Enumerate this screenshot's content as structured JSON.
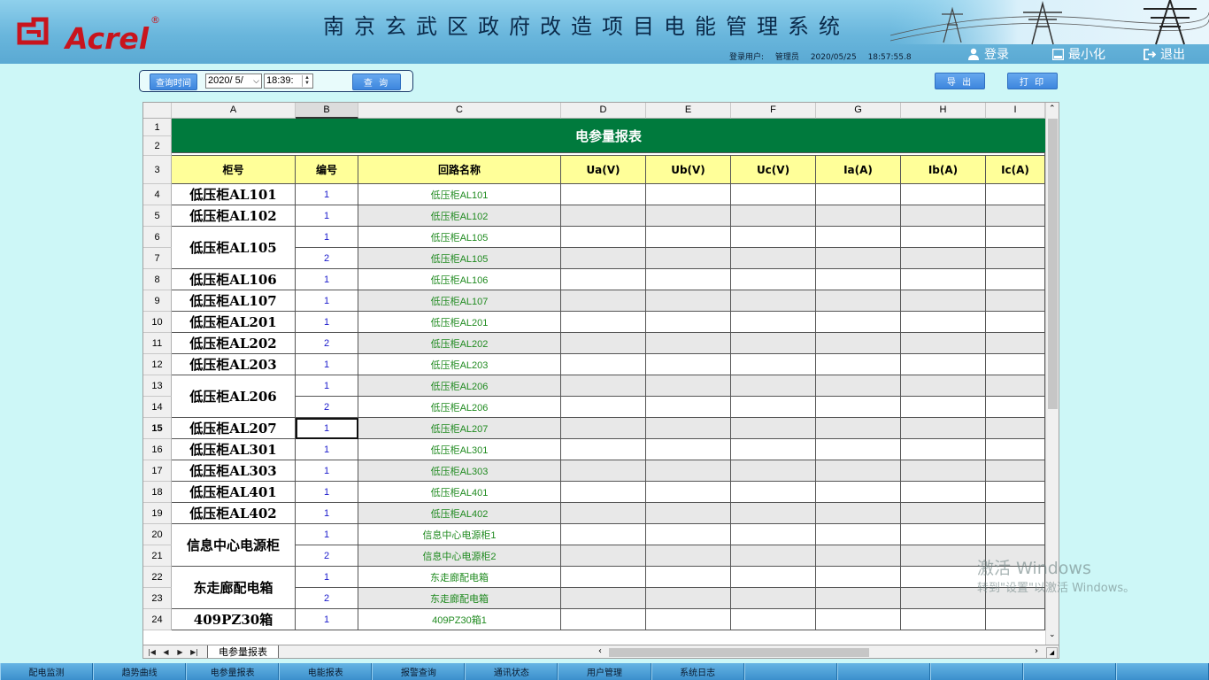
{
  "header": {
    "logo_text": "Acrel",
    "logo_reg": "®",
    "system_title": "南京玄武区政府改造项目电能管理系统",
    "user_label": "登录用户:",
    "user_name": "管理员",
    "date": "2020/05/25",
    "time": "18:57:55.8",
    "login_label": "登录",
    "minimize_label": "最小化",
    "exit_label": "退出"
  },
  "query": {
    "query_time_label": "查询时间",
    "date_value": "2020/ 5/",
    "time_value": "18:39:",
    "query_button": "查 询",
    "export_button": "导 出",
    "print_button": "打 印"
  },
  "sheet": {
    "columns": [
      "A",
      "B",
      "C",
      "D",
      "E",
      "F",
      "G",
      "H",
      "I"
    ],
    "title": "电参量报表",
    "headers": [
      "柜号",
      "编号",
      "回路名称",
      "Ua(V)",
      "Ub(V)",
      "Uc(V)",
      "Ia(A)",
      "Ib(A)",
      "Ic(A)"
    ],
    "row_numbers": [
      "1",
      "2",
      "3",
      "4",
      "5",
      "6",
      "7",
      "8",
      "9",
      "10",
      "11",
      "12",
      "13",
      "14",
      "15",
      "16",
      "17",
      "18",
      "19",
      "20",
      "21",
      "22",
      "23",
      "24"
    ],
    "rows": [
      {
        "cabinet": "低压柜AL101",
        "span": 1,
        "num": "1",
        "loop": "低压柜AL101"
      },
      {
        "cabinet": "低压柜AL102",
        "span": 1,
        "num": "1",
        "loop": "低压柜AL102"
      },
      {
        "cabinet": "低压柜AL105",
        "span": 2,
        "num": "1",
        "loop": "低压柜AL105"
      },
      {
        "cabinet": "",
        "span": 0,
        "num": "2",
        "loop": "低压柜AL105"
      },
      {
        "cabinet": "低压柜AL106",
        "span": 1,
        "num": "1",
        "loop": "低压柜AL106"
      },
      {
        "cabinet": "低压柜AL107",
        "span": 1,
        "num": "1",
        "loop": "低压柜AL107"
      },
      {
        "cabinet": "低压柜AL201",
        "span": 1,
        "num": "1",
        "loop": "低压柜AL201"
      },
      {
        "cabinet": "低压柜AL202",
        "span": 1,
        "num": "2",
        "loop": "低压柜AL202"
      },
      {
        "cabinet": "低压柜AL203",
        "span": 1,
        "num": "1",
        "loop": "低压柜AL203"
      },
      {
        "cabinet": "低压柜AL206",
        "span": 2,
        "num": "1",
        "loop": "低压柜AL206"
      },
      {
        "cabinet": "",
        "span": 0,
        "num": "2",
        "loop": "低压柜AL206"
      },
      {
        "cabinet": "低压柜AL207",
        "span": 1,
        "num": "1",
        "loop": "低压柜AL207"
      },
      {
        "cabinet": "低压柜AL301",
        "span": 1,
        "num": "1",
        "loop": "低压柜AL301"
      },
      {
        "cabinet": "低压柜AL303",
        "span": 1,
        "num": "1",
        "loop": "低压柜AL303"
      },
      {
        "cabinet": "低压柜AL401",
        "span": 1,
        "num": "1",
        "loop": "低压柜AL401"
      },
      {
        "cabinet": "低压柜AL402",
        "span": 1,
        "num": "1",
        "loop": "低压柜AL402"
      },
      {
        "cabinet": "信息中心电源柜",
        "span": 2,
        "num": "1",
        "loop": "信息中心电源柜1"
      },
      {
        "cabinet": "",
        "span": 0,
        "num": "2",
        "loop": "信息中心电源柜2"
      },
      {
        "cabinet": "东走廊配电箱",
        "span": 2,
        "num": "1",
        "loop": "东走廊配电箱"
      },
      {
        "cabinet": "",
        "span": 0,
        "num": "2",
        "loop": "东走廊配电箱"
      },
      {
        "cabinet": "409PZ30箱",
        "span": 1,
        "num": "1",
        "loop": "409PZ30箱1"
      }
    ],
    "tab_label": "电参量报表"
  },
  "watermark": {
    "line1": "激活 Windows",
    "line2": "转到\"设置\"以激活 Windows。"
  },
  "bottom_nav": [
    "配电监测",
    "趋势曲线",
    "电参量报表",
    "电能报表",
    "报警查询",
    "通讯状态",
    "用户管理",
    "系统日志",
    "",
    "",
    "",
    "",
    ""
  ],
  "colors": {
    "title_bar": "#007a3d",
    "header_fill": "#ffff99",
    "alt_row": "#e8e8e8",
    "loop_text": "#1f8a1f",
    "num_text": "#1a1acc",
    "logo_red": "#c8141d"
  }
}
